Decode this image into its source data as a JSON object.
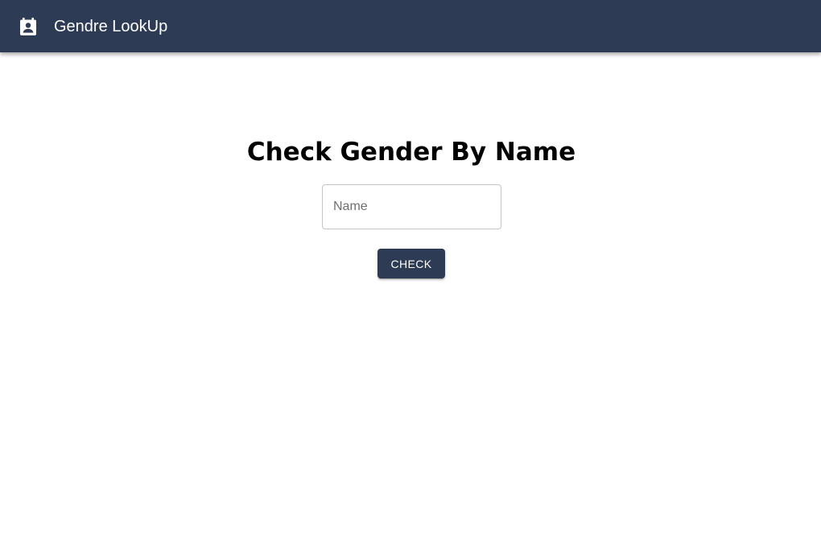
{
  "appbar": {
    "title": "Gendre LookUp",
    "icon": "contact-calendar-icon",
    "background_color": "#2e3b55"
  },
  "main": {
    "heading": "Check Gender By Name",
    "name_input": {
      "placeholder": "Name",
      "value": ""
    },
    "check_button_label": "CHECK",
    "button_color": "#2e3b55"
  }
}
